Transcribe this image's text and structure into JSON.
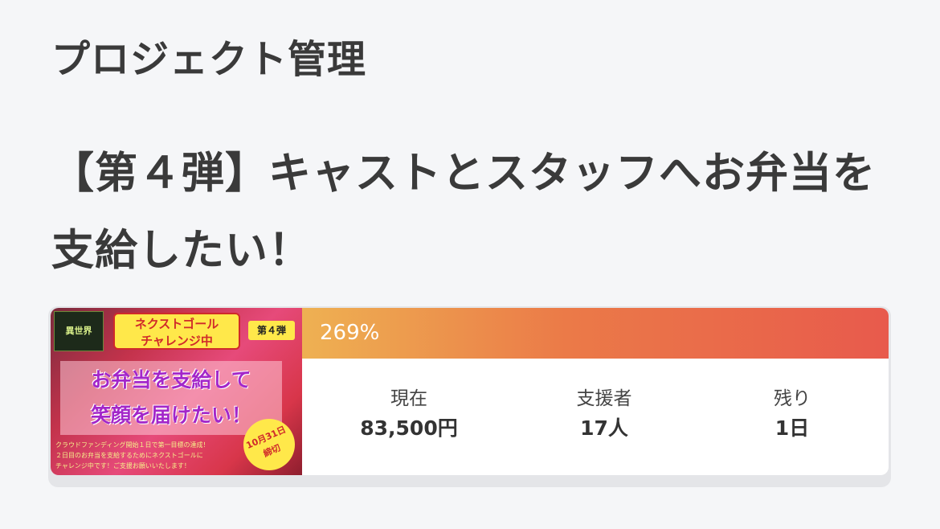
{
  "header": {
    "section_title": "プロジェクト管理"
  },
  "project": {
    "title": "【第４弾】キャストとスタッフへお弁当を支給したい！",
    "thumbnail": {
      "logo_text": "異世界",
      "goal_badge_line1": "ネクストゴール",
      "goal_badge_line2": "チャレンジ中",
      "volume_badge": "第４弾",
      "headline_line1": "お弁当を支給して",
      "headline_line2": "笑顔を届けたい！",
      "note_line1": "クラウドファンディング開始１日で第一目標の達成！",
      "note_line2": "２日目のお弁当を支給するためにネクストゴールに",
      "note_line3": "チャレンジ中です！ご支援お願いいたします！",
      "date_line1": "10月31日",
      "date_line2": "締切"
    },
    "progress": {
      "label": "269%",
      "percent": 269
    },
    "stats": {
      "current_label": "現在",
      "current_value": "83,500円",
      "backers_label": "支援者",
      "backers_value": "17人",
      "remaining_label": "残り",
      "remaining_value": "1日"
    }
  },
  "colors": {
    "background": "#f5f6f8",
    "progress_start": "#eeb152",
    "progress_end": "#e85a4c",
    "text": "#3a3a3a"
  }
}
